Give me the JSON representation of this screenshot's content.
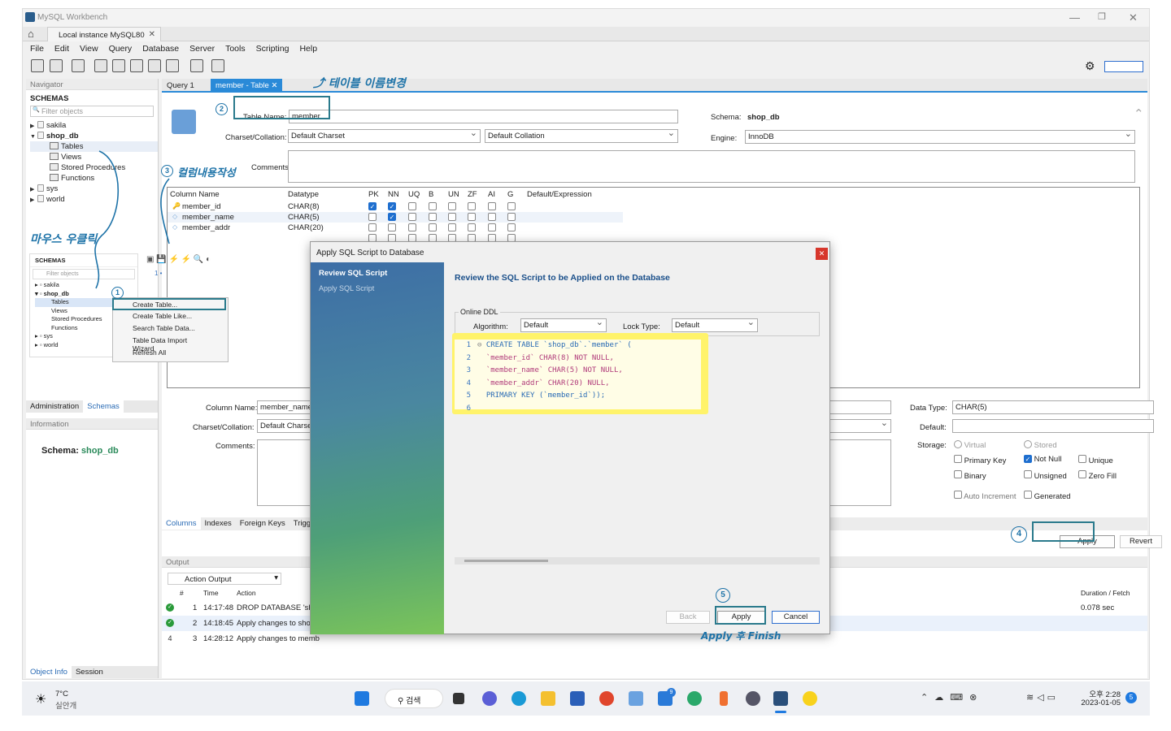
{
  "window": {
    "title": "MySQL Workbench",
    "tab": "Local instance MySQL80"
  },
  "menu": [
    "File",
    "Edit",
    "View",
    "Query",
    "Database",
    "Server",
    "Tools",
    "Scripting",
    "Help"
  ],
  "navigator": {
    "header": "Navigator",
    "schemas_label": "SCHEMAS",
    "filter_placeholder": "Filter objects",
    "tree": [
      {
        "name": "sakila",
        "expanded": false
      },
      {
        "name": "shop_db",
        "expanded": true,
        "children": [
          "Tables",
          "Views",
          "Stored Procedures",
          "Functions"
        ]
      },
      {
        "name": "sys",
        "expanded": false
      },
      {
        "name": "world",
        "expanded": false
      }
    ],
    "bottom_tabs": [
      "Administration",
      "Schemas"
    ],
    "info_header": "Information",
    "info_label": "Schema:",
    "info_value": "shop_db",
    "footer_tabs": [
      "Object Info",
      "Session"
    ]
  },
  "editor_tabs": [
    "Query 1",
    "member - Table"
  ],
  "table_editor": {
    "table_name_label": "Table Name:",
    "table_name": "member",
    "schema_label": "Schema:",
    "schema": "shop_db",
    "charset_label": "Charset/Collation:",
    "charset": "Default Charset",
    "collation": "Default Collation",
    "engine_label": "Engine:",
    "engine": "InnoDB",
    "comments_label": "Comments:",
    "grid_headers": [
      "Column Name",
      "Datatype",
      "PK",
      "NN",
      "UQ",
      "B",
      "UN",
      "ZF",
      "AI",
      "G",
      "Default/Expression"
    ],
    "columns": [
      {
        "name": "member_id",
        "type": "CHAR(8)",
        "pk": true,
        "nn": true
      },
      {
        "name": "member_name",
        "type": "CHAR(5)",
        "pk": false,
        "nn": true
      },
      {
        "name": "member_addr",
        "type": "CHAR(20)",
        "pk": false,
        "nn": false
      }
    ],
    "detail": {
      "column_name_label": "Column Name:",
      "column_name": "member_name",
      "charset_label": "Charset/Collation:",
      "charset": "Default Charset",
      "comments_label": "Comments:",
      "datatype_label": "Data Type:",
      "datatype": "CHAR(5)",
      "default_label": "Default:",
      "storage_label": "Storage:",
      "virtual": "Virtual",
      "stored": "Stored",
      "primary_key": "Primary Key",
      "not_null": "Not Null",
      "unique": "Unique",
      "binary": "Binary",
      "unsigned": "Unsigned",
      "zero_fill": "Zero Fill",
      "auto_increment": "Auto Increment",
      "generated": "Generated"
    },
    "bottom_tabs": [
      "Columns",
      "Indexes",
      "Foreign Keys",
      "Trigg"
    ],
    "apply": "Apply",
    "revert": "Revert"
  },
  "output": {
    "header": "Output",
    "selector": "Action Output",
    "col_num": "#",
    "col_time": "Time",
    "col_action": "Action",
    "col_duration": "Duration / Fetch",
    "rows": [
      {
        "n": "1",
        "time": "14:17:48",
        "action": "DROP DATABASE 'sho",
        "duration": "0.078 sec",
        "status": "ok"
      },
      {
        "n": "2",
        "time": "14:18:45",
        "action": "Apply changes to shop_",
        "duration": "",
        "status": "ok"
      },
      {
        "n": "3",
        "time": "14:28:12",
        "action": "Apply changes to memb",
        "duration": "",
        "status": "pending"
      }
    ]
  },
  "mini_nav": {
    "schemas_label": "SCHEMAS",
    "filter_placeholder": "Filter objects",
    "items": [
      "sakila",
      "shop_db",
      "Tables",
      "Views",
      "Stored Procedures",
      "Functions",
      "sys",
      "world"
    ]
  },
  "context_menu": [
    "Create Table...",
    "Create Table Like...",
    "Search Table Data...",
    "Table Data Import Wizard",
    "Refresh All"
  ],
  "dialog": {
    "title": "Apply SQL Script to Database",
    "steps": [
      "Review SQL Script",
      "Apply SQL Script"
    ],
    "heading": "Review the SQL Script to be Applied on the Database",
    "online_ddl": "Online DDL",
    "algorithm_label": "Algorithm:",
    "algorithm": "Default",
    "lock_label": "Lock Type:",
    "lock": "Default",
    "sql": [
      "CREATE TABLE `shop_db`.`member` (",
      "  `member_id` CHAR(8) NOT NULL,",
      "  `member_name` CHAR(5) NOT NULL,",
      "  `member_addr` CHAR(20) NULL,",
      "  PRIMARY KEY (`member_id`));",
      ""
    ],
    "back": "Back",
    "apply": "Apply",
    "cancel": "Cancel"
  },
  "annotations": {
    "rename": "테이블 이름변경",
    "columns": "컬럼내용작성",
    "right_click": "마우스 우클릭",
    "apply_finish": "Apply 후 Finish",
    "n1": "1",
    "n2": "2",
    "n3": "3",
    "n4": "4",
    "n5": "5"
  },
  "taskbar": {
    "weather_temp": "7°C",
    "weather_desc": "실안개",
    "search": "검색",
    "time": "오후 2:28",
    "date": "2023-01-05",
    "notif": "5",
    "mail_badge": "9"
  }
}
